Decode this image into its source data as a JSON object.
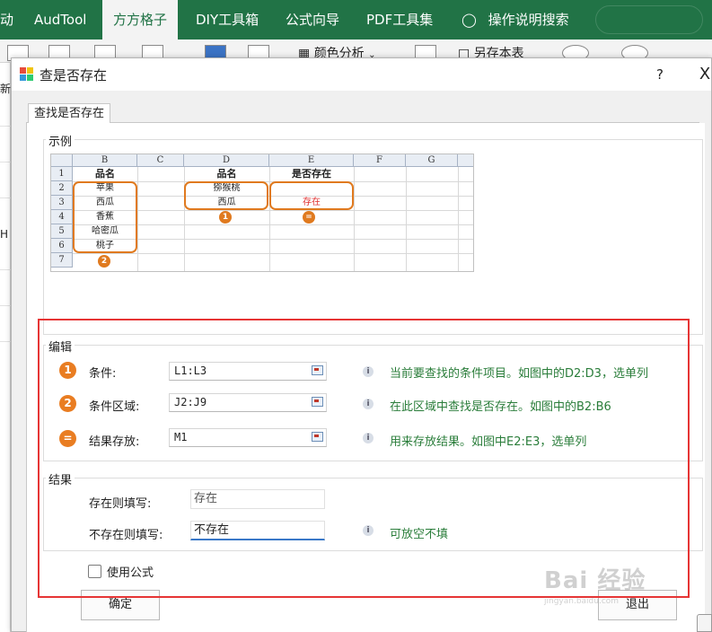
{
  "ribbon": {
    "tabs": [
      "动",
      "AudTool",
      "方方格子",
      "DIY工具箱",
      "公式向导",
      "PDF工具集",
      "操作说明搜索"
    ],
    "active_tab": "方方格子",
    "tool_labels": {
      "color_analysis": "颜色分析",
      "save_sheet": "另存本表"
    },
    "accent_color": "#217346"
  },
  "sheet_side": {
    "labels": [
      "新",
      "H"
    ]
  },
  "dialog": {
    "title": "查是否存在",
    "help": "?",
    "close": "X",
    "tab": "查找是否存在",
    "example": {
      "label": "示例",
      "columns": [
        "B",
        "C",
        "D",
        "E",
        "F",
        "G"
      ],
      "rows": [
        "1",
        "2",
        "3",
        "4",
        "5",
        "6",
        "7"
      ],
      "b_header": "品名",
      "b_items": [
        "苹果",
        "西瓜",
        "香蕉",
        "哈密瓜",
        "桃子"
      ],
      "d_header": "品名",
      "d_items": [
        "猕猴桃",
        "西瓜"
      ],
      "e_header": "是否存在",
      "e_items": [
        "",
        "存在"
      ],
      "markers": [
        "1",
        "=",
        "2"
      ]
    },
    "edit": {
      "label": "编辑",
      "rows": [
        {
          "badge": "1",
          "label": "条件:",
          "value": "L1:L3",
          "hint": "当前要查找的条件项目。如图中的D2:D3，选单列"
        },
        {
          "badge": "2",
          "label": "条件区域:",
          "value": "J2:J9",
          "hint": "在此区域中查找是否存在。如图中的B2:B6"
        },
        {
          "badge": "=",
          "label": "结果存放:",
          "value": "M1",
          "hint": "用来存放结果。如图中E2:E3，选单列"
        }
      ]
    },
    "result": {
      "label": "结果",
      "exists_label": "存在则填写:",
      "exists_value": "存在",
      "not_exists_label": "不存在则填写:",
      "not_exists_value": "不存在",
      "not_exists_hint": "可放空不填"
    },
    "use_formula": "使用公式",
    "ok": "确定",
    "exit": "退出"
  },
  "watermark": {
    "big": "Bai 经验",
    "small": "jingyan.baidu.com"
  },
  "info_glyph": "i",
  "colors": {
    "badge": "#e97d22",
    "hint": "#2a7d3a",
    "highlight_box": "#e63535",
    "exist_text": "#e03030"
  }
}
